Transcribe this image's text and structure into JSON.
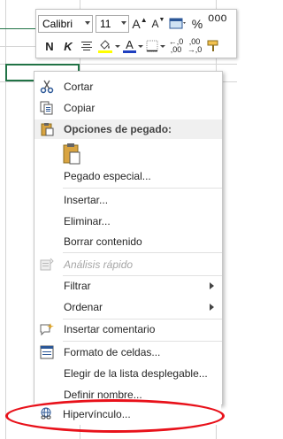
{
  "toolbar": {
    "font_name": "Calibri",
    "font_size": "11",
    "bold": "N",
    "italic": "K",
    "percent": "%",
    "increase_font": "A",
    "decrease_font": "A",
    "font_color_letter": "A",
    "fill_color": "#ffff00",
    "font_color": "#1f3fbf",
    "dec_decimals": "←,0 ,00",
    "inc_decimals": ",00 →,0"
  },
  "menu": {
    "cut": "Cortar",
    "copy": "Copiar",
    "paste_options": "Opciones de pegado:",
    "paste_special": "Pegado especial...",
    "insert": "Insertar...",
    "delete": "Eliminar...",
    "clear_contents": "Borrar contenido",
    "quick_analysis": "Análisis rápido",
    "filter": "Filtrar",
    "sort": "Ordenar",
    "insert_comment": "Insertar comentario",
    "format_cells": "Formato de celdas...",
    "pick_from_list": "Elegir de la lista desplegable...",
    "define_name": "Definir nombre...",
    "hyperlink": "Hipervínculo..."
  },
  "colors": {
    "accent": "#217346",
    "highlight_ellipse": "#e8111a"
  }
}
